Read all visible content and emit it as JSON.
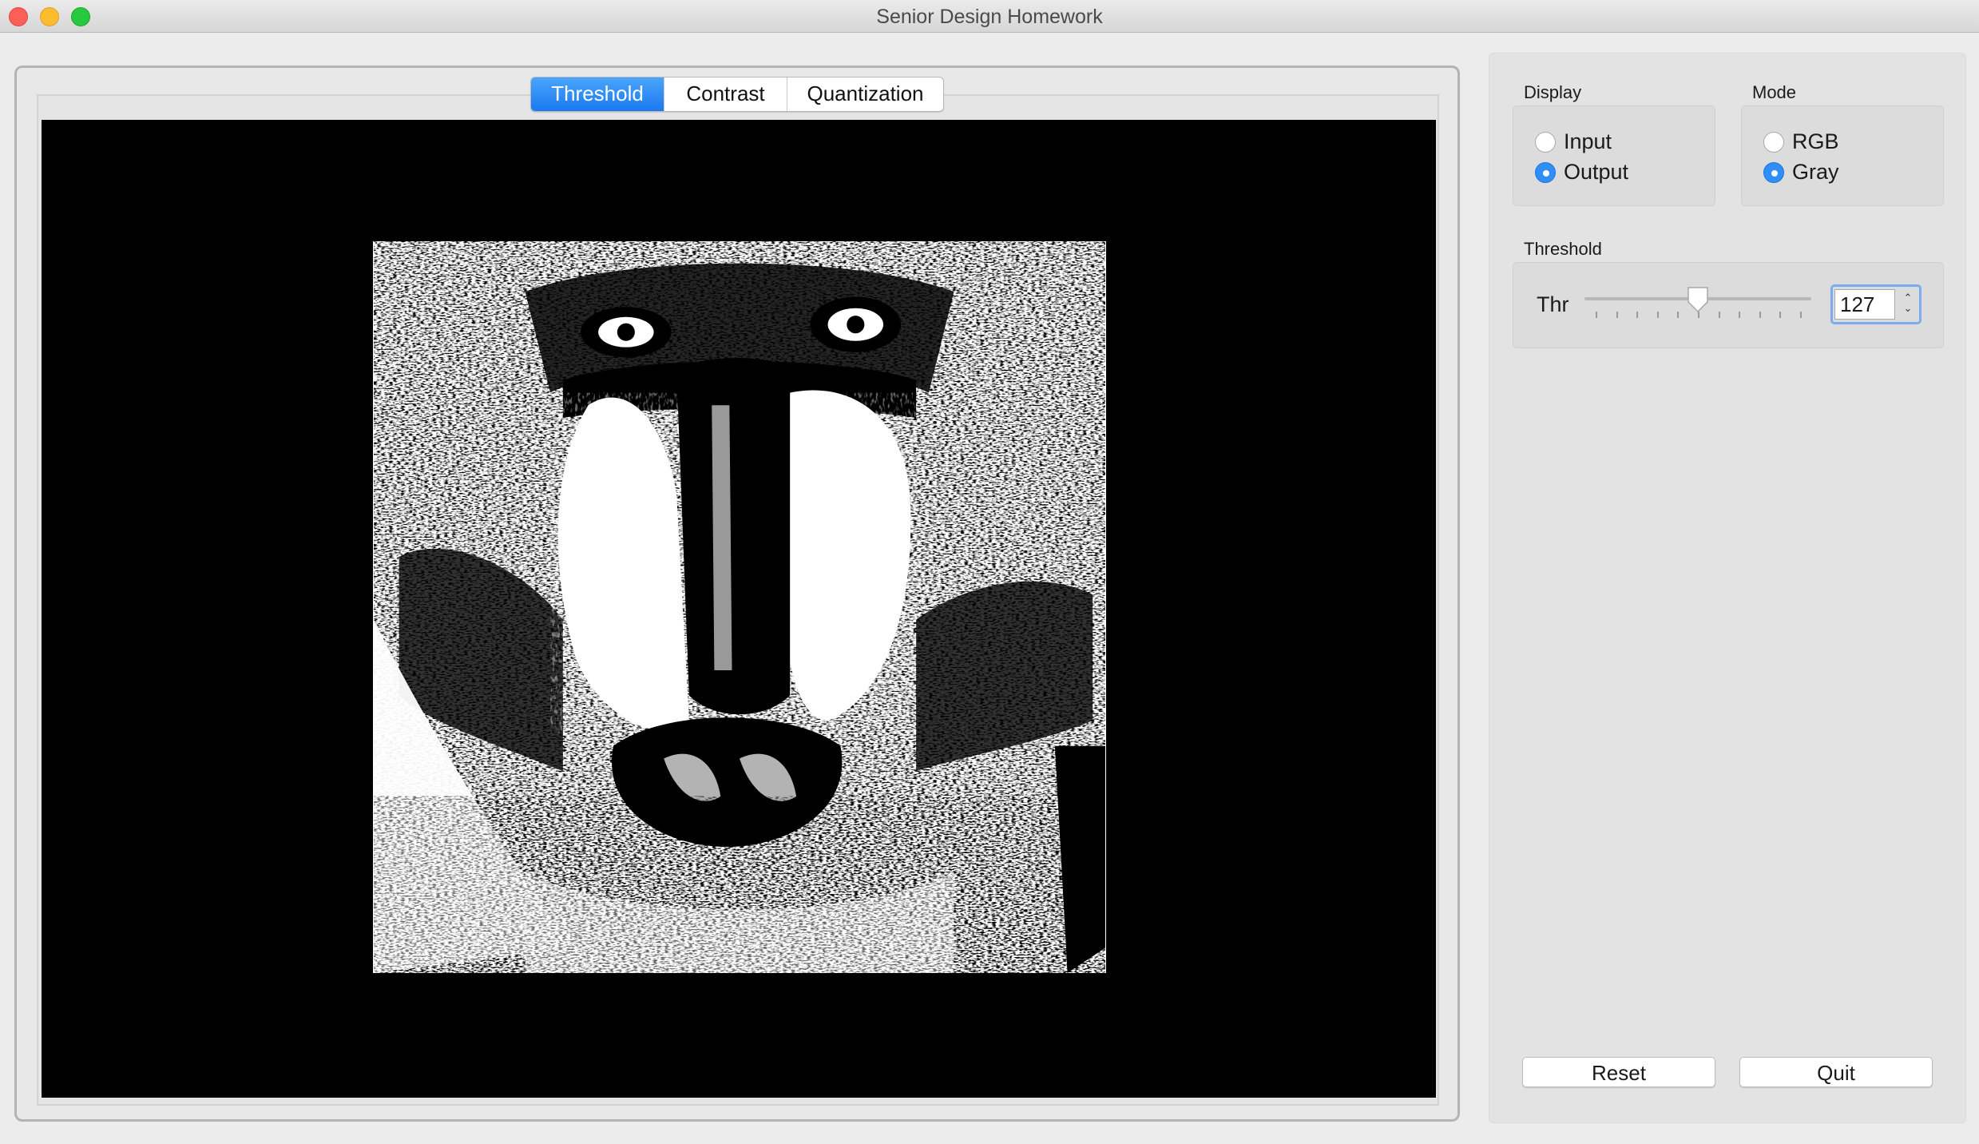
{
  "window": {
    "title": "Senior Design Homework"
  },
  "tabs": [
    {
      "label": "Threshold",
      "active": true
    },
    {
      "label": "Contrast",
      "active": false
    },
    {
      "label": "Quantization",
      "active": false
    }
  ],
  "display_group": {
    "title": "Display",
    "options": [
      {
        "label": "Input",
        "selected": false
      },
      {
        "label": "Output",
        "selected": true
      }
    ]
  },
  "mode_group": {
    "title": "Mode",
    "options": [
      {
        "label": "RGB",
        "selected": false
      },
      {
        "label": "Gray",
        "selected": true
      }
    ]
  },
  "threshold_group": {
    "title": "Threshold",
    "label": "Thr",
    "value": "127",
    "slider_fraction": 0.5
  },
  "buttons": {
    "reset": "Reset",
    "quit": "Quit"
  },
  "colors": {
    "accent": "#2f8ff6",
    "tab_active": "#1b78f1",
    "canvas_bg": "#000000"
  },
  "icons": {
    "spin_up": "chevron-up-icon",
    "spin_down": "chevron-down-icon"
  }
}
